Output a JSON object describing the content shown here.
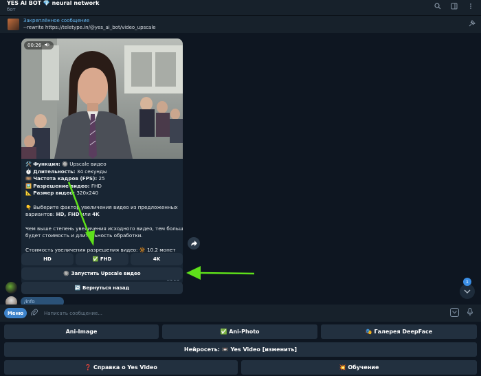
{
  "header": {
    "title": "YES AI BOT 💎 neural network",
    "subtitle": "бот"
  },
  "pinned": {
    "title": "Закреплённое сообщение",
    "text": "--rewrite https://teletype.in/@yes_ai_bot/video_upscale"
  },
  "message": {
    "video_duration": "00:26",
    "function_label": "Функция:",
    "function_value": "🔘 Upscale видео",
    "duration_label": "Длительность:",
    "duration_value": "34 секунды",
    "fps_label": "Частота кадров (FPS):",
    "fps_value": "25",
    "resolution_label": "Разрешение видео:",
    "resolution_value": "FHD",
    "size_label": "Размер видео:",
    "size_value": "320x240",
    "prompt_line1": "👇 Выберите фактор увеличения видео из предложенных",
    "prompt_line2_prefix": "вариантов:",
    "prompt_line2_options": "HD, FHD",
    "prompt_line2_or": "или",
    "prompt_line2_last": "4K",
    "info_line1": "Чем выше степень увеличения исходного видео, тем больше",
    "info_line2": "будет стоимость и длительность обработки.",
    "cost": "Стоимость увеличения разрешения видео: 🔆 10.2 монет",
    "time": "14:29"
  },
  "inline_keyboard": {
    "hd": "HD",
    "fhd": "✅ FHD",
    "fourk": "4K",
    "start": "🔘 Запустить Upscale видео",
    "back": "↩️ Вернуться назад"
  },
  "info_bubble": "/info",
  "unread_count": "1",
  "input": {
    "menu_label": "Меню",
    "placeholder": "Написать сообщение..."
  },
  "reply_keyboard": {
    "ani_image": "Ani-Image",
    "ani_photo": "✅ Ani-Photo",
    "gallery": "🎭 Галерея DeepFace",
    "network": "Нейросеть: 📼 Yes Video [изменить]",
    "help": "❓ Справка о Yes Video",
    "learn": "💥 Обучение"
  },
  "colors": {
    "background": "#0e1621",
    "panel": "#17212b",
    "bubble": "#182533",
    "button": "#22303f",
    "accent": "#3d82c9",
    "link": "#64b5ef",
    "arrow": "#5ee01a"
  }
}
